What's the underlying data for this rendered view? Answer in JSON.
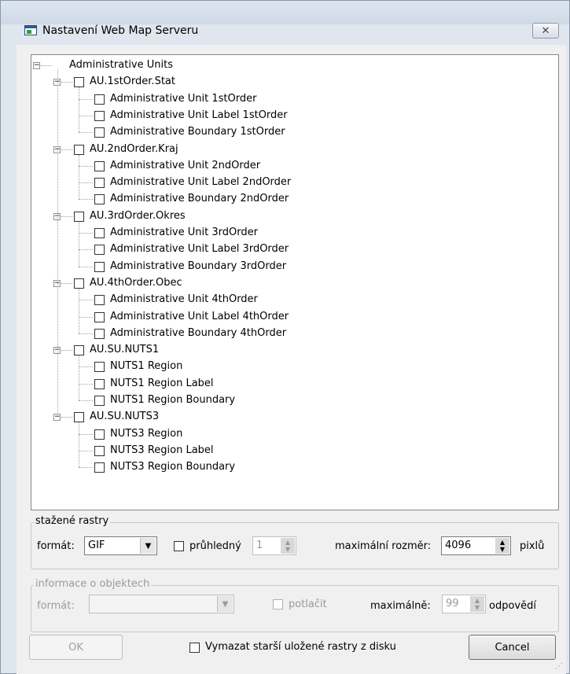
{
  "window": {
    "title": "Nastavení Web Map Serveru",
    "close_icon": "close-icon"
  },
  "tree": {
    "root": "Administrative Units",
    "groups": [
      {
        "label": "AU.1stOrder.Stat",
        "children": [
          "Administrative Unit 1stOrder",
          "Administrative Unit Label 1stOrder",
          "Administrative Boundary 1stOrder"
        ]
      },
      {
        "label": "AU.2ndOrder.Kraj",
        "children": [
          "Administrative Unit 2ndOrder",
          "Administrative Unit Label 2ndOrder",
          "Administrative Boundary 2ndOrder"
        ]
      },
      {
        "label": "AU.3rdOrder.Okres",
        "children": [
          "Administrative Unit 3rdOrder",
          "Administrative Unit Label 3rdOrder",
          "Administrative Boundary 3rdOrder"
        ]
      },
      {
        "label": "AU.4thOrder.Obec",
        "children": [
          "Administrative Unit 4thOrder",
          "Administrative Unit Label 4thOrder",
          "Administrative Boundary 4thOrder"
        ]
      },
      {
        "label": "AU.SU.NUTS1",
        "children": [
          "NUTS1 Region",
          "NUTS1 Region Label",
          "NUTS1 Region Boundary"
        ]
      },
      {
        "label": "AU.SU.NUTS3",
        "children": [
          "NUTS3 Region",
          "NUTS3 Region Label",
          "NUTS3 Region Boundary"
        ]
      }
    ]
  },
  "rasters": {
    "legend": "stažené rastry",
    "format_label": "formát:",
    "format_value": "GIF",
    "transparent_label": "průhledný",
    "transparent_value": "1",
    "max_size_label": "maximální rozměr:",
    "max_size_value": "4096",
    "unit": "pixlů"
  },
  "objects": {
    "legend": "informace o objektech",
    "format_label": "formát:",
    "format_value": "",
    "suppress_label": "potlačit",
    "max_label": "maximálně:",
    "max_value": "99",
    "unit": "odpovědí"
  },
  "footer": {
    "ok_label": "OK",
    "delete_label": "Vymazat starší uložené rastry z disku",
    "cancel_label": "Cancel"
  },
  "colors": {
    "title_bg": "#dde6f0",
    "client_bg": "#f0f0f0",
    "tree_bg": "#ffffff"
  }
}
